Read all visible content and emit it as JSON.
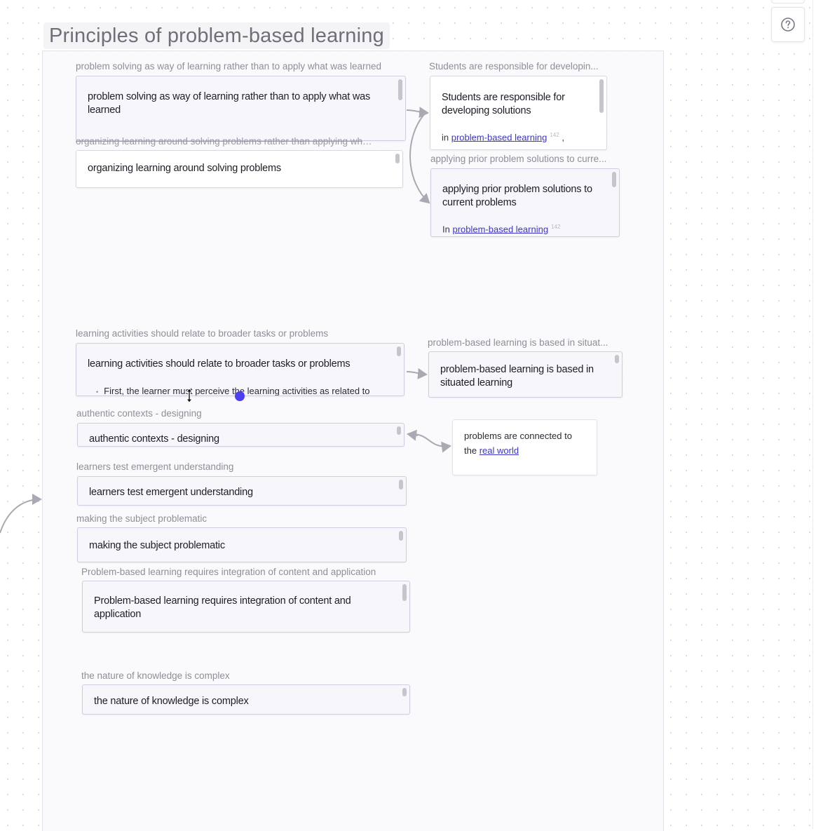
{
  "title": "Principles of problem-based learning",
  "help_button": {
    "icon": "question-circle-icon"
  },
  "cards": {
    "c1": {
      "label": "problem solving as way of learning rather than to apply what was learned",
      "text": "problem solving as way of learning rather than to apply what was learned"
    },
    "c2": {
      "label": "organizing learning around solving problems rather than applying what was",
      "text": "organizing learning around solving problems"
    },
    "c3": {
      "label": "learning activities should relate to broader tasks or problems",
      "text": "learning activities should relate to broader tasks or problems",
      "bullet": "First, the learner must perceive the learning activities as related to"
    },
    "c4": {
      "label": "authentic contexts - designing",
      "text": "authentic contexts - designing"
    },
    "c5": {
      "label": "learners test emergent understanding",
      "text": "learners test emergent understanding"
    },
    "c6": {
      "label": "making the subject problematic",
      "text": "making the subject problematic"
    },
    "c7": {
      "label": "Problem-based learning requires integration of content and application",
      "text": "Problem-based learning requires integration of content and application"
    },
    "c8": {
      "label": "the nature of knowledge is complex",
      "text": "the nature of knowledge is complex"
    },
    "r1": {
      "label": "Students are responsible for developin...",
      "text": "Students are responsible for developing solutions",
      "in_prefix": "in",
      "link": "problem-based learning",
      "ref": "142",
      "suffix": ","
    },
    "r2": {
      "label": "applying prior problem solutions to curre...",
      "text": "applying prior problem solutions to current problems",
      "in_prefix": "In",
      "link": "problem-based learning",
      "ref": "142"
    },
    "r3": {
      "label": "problem-based learning is based in situat...",
      "text": "problem-based learning is based in situated learning"
    },
    "r4": {
      "text_prefix": "problems are connected to the",
      "link": "real world"
    }
  },
  "colors": {
    "accent": "#3d36c9",
    "cursor_dot": "#4b3ff0",
    "arrow": "#a9a9b3"
  }
}
